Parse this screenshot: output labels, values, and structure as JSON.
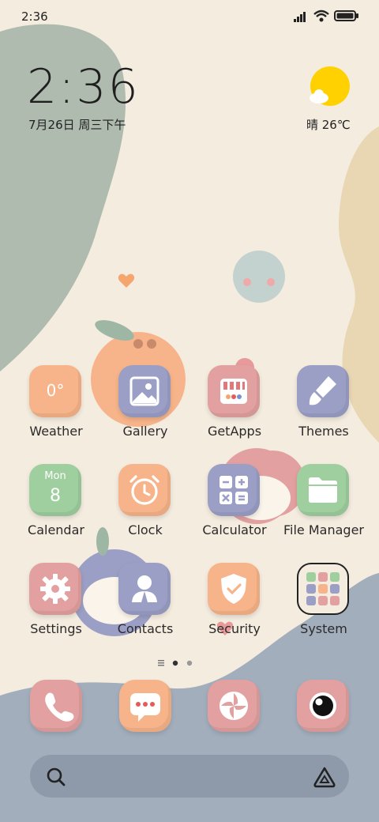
{
  "status_bar": {
    "time": "2:36",
    "icons": [
      "signal-icon",
      "wifi-icon",
      "battery-icon"
    ]
  },
  "clock_widget": {
    "time": "2:36",
    "date": "7月26日 周三下午"
  },
  "weather_widget": {
    "text": "晴 26℃",
    "icon": "sun-cloud-icon"
  },
  "apps": [
    {
      "name": "weather",
      "label": "Weather",
      "icon_text": "0°",
      "color": "#f7b48a"
    },
    {
      "name": "gallery",
      "label": "Gallery",
      "icon_text": "",
      "color": "#9b9fc5"
    },
    {
      "name": "getapps",
      "label": "GetApps",
      "icon_text": "",
      "color": "#e3a0a0"
    },
    {
      "name": "themes",
      "label": "Themes",
      "icon_text": "",
      "color": "#9b9fc5"
    },
    {
      "name": "calendar",
      "label": "Calendar",
      "icon_text": "8",
      "icon_subtext": "Mon",
      "color": "#9fcf9f"
    },
    {
      "name": "clock",
      "label": "Clock",
      "icon_text": "",
      "color": "#f7b48a"
    },
    {
      "name": "calculator",
      "label": "Calculator",
      "icon_text": "",
      "color": "#9b9fc5"
    },
    {
      "name": "file-manager",
      "label": "File Manager",
      "icon_text": "",
      "color": "#9fcf9f"
    },
    {
      "name": "settings",
      "label": "Settings",
      "icon_text": "",
      "color": "#e3a0a0"
    },
    {
      "name": "contacts",
      "label": "Contacts",
      "icon_text": "",
      "color": "#9b9fc5"
    },
    {
      "name": "security",
      "label": "Security",
      "icon_text": "",
      "color": "#f7b48a"
    },
    {
      "name": "system",
      "label": "System",
      "icon_text": "",
      "color": "#f4ecdf"
    }
  ],
  "dock": [
    {
      "name": "phone",
      "icon": "phone-icon",
      "color": "#e3a0a0"
    },
    {
      "name": "messages",
      "icon": "message-icon",
      "color": "#f7b48a"
    },
    {
      "name": "browser",
      "icon": "aperture-icon",
      "color": "#e3a0a0"
    },
    {
      "name": "camera",
      "icon": "camera-icon",
      "color": "#e3a0a0"
    }
  ],
  "page_indicator": {
    "pages": 2,
    "current": 1
  },
  "search_bar": {
    "icon": "search-icon",
    "assistant_icon": "assistant-icon"
  },
  "colors": {
    "background": "#f4ecdf",
    "sage": "#aebbae",
    "sand": "#e9d6b2",
    "slate": "#a3aebd",
    "sun": "#ffd100"
  }
}
